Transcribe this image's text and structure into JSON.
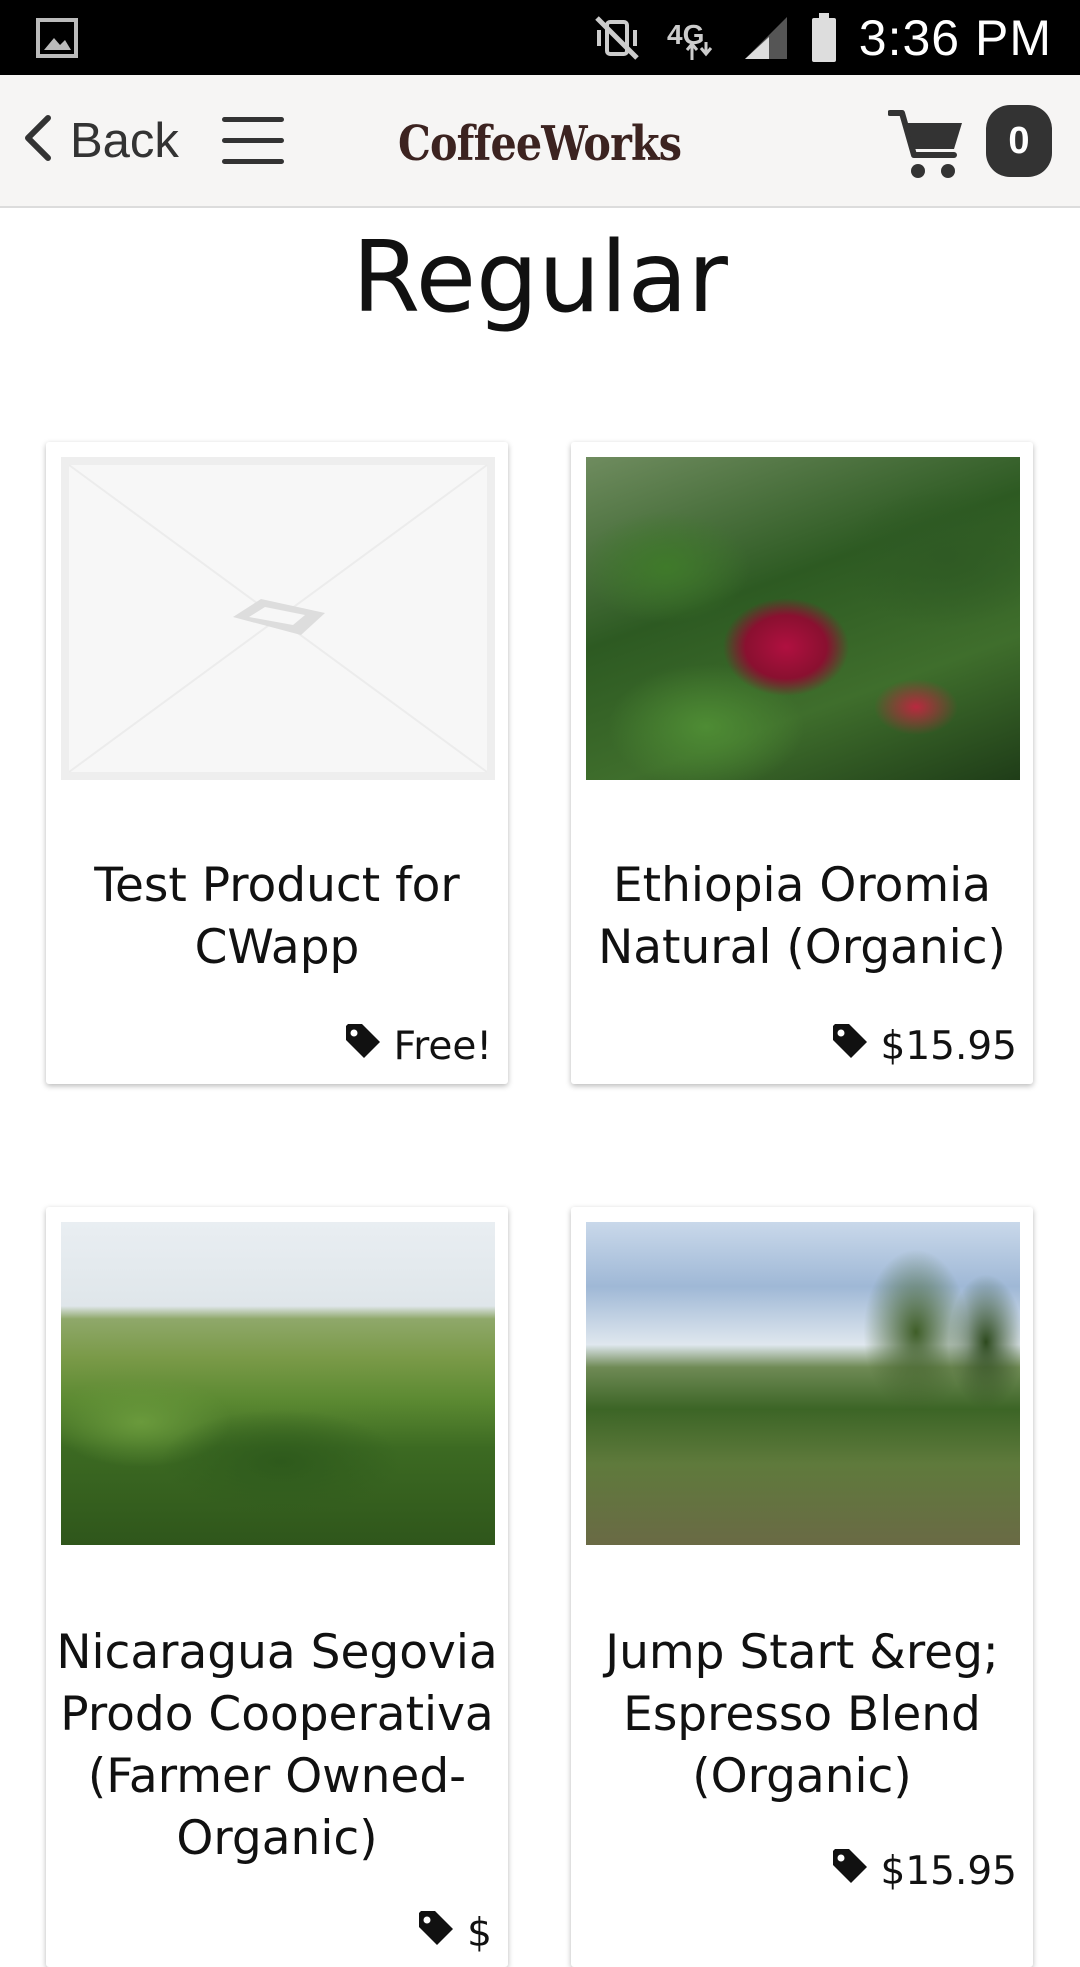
{
  "status_bar": {
    "network": "4G",
    "time": "3:36 PM"
  },
  "header": {
    "back_label": "Back",
    "logo_text": "CoffeeWorks",
    "cart_count": "0"
  },
  "page": {
    "title": "Regular"
  },
  "products": [
    {
      "name": "Test Product for CWapp",
      "price": "Free!",
      "image": "placeholder-image"
    },
    {
      "name": "Ethiopia Oromia Natural (Organic)",
      "price": "$15.95",
      "image": "coffee-cherries-photo"
    },
    {
      "name": "Nicaragua Segovia Prodo Cooperativa (Farmer Owned-Organic)",
      "price": "$",
      "image": "coffee-farm-banana-trees-photo"
    },
    {
      "name": "Jump Start &reg; Espresso Blend (Organic)",
      "price": "$15.95",
      "image": "coffee-plantation-rows-photo"
    }
  ],
  "colors": {
    "status_bar": "#000000",
    "header_bg": "#f6f5f4",
    "logo": "#3c2320",
    "badge": "#333333"
  }
}
